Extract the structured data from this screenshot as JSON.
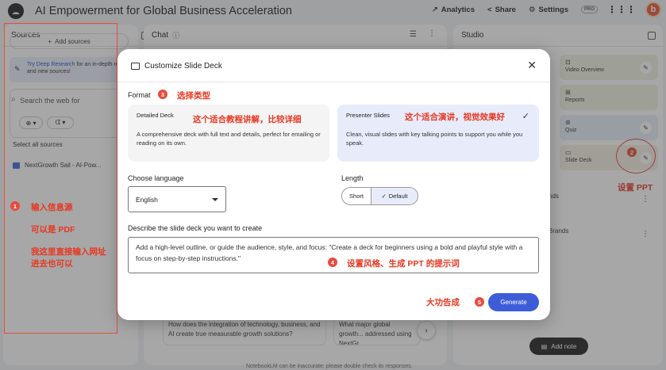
{
  "app": {
    "title": "AI Empowerment for Global Business Acceleration",
    "avatar_letter": "b"
  },
  "topbar": {
    "analytics": "Analytics",
    "share": "Share",
    "settings": "Settings",
    "pro": "PRO"
  },
  "sources": {
    "title": "Sources",
    "add_label": "Add sources",
    "deep_research_link": "Try Deep Research",
    "deep_research_text": "for an in-depth report and new sources!",
    "search_placeholder": "Search the web for",
    "select_all": "Select all sources",
    "items": [
      {
        "label": "NextGrowth Sail - AI-Pow..."
      }
    ]
  },
  "chat": {
    "title": "Chat",
    "suggestions": [
      "How does the integration of technology, business, and AI create true measurable growth solutions?",
      "What major global growth... addressed using NextGr..."
    ],
    "footer": "NotebookLM can be inaccurate; please double check its responses."
  },
  "studio": {
    "title": "Studio",
    "cards": [
      {
        "label": "Video Overview",
        "icon": "video-icon",
        "color": "#eef3e4"
      },
      {
        "label": "Reports",
        "icon": "report-icon",
        "color": "#eef3e4"
      },
      {
        "label": "Quiz",
        "icon": "quiz-icon",
        "color": "#e6eef9"
      },
      {
        "label": "Slide Deck",
        "icon": "slides-icon",
        "color": "#f4efe4"
      }
    ],
    "rows": [
      "nds",
      "Brands"
    ],
    "add_note": "Add note"
  },
  "modal": {
    "title": "Customize Slide Deck",
    "format_label": "Format",
    "formats": [
      {
        "title": "Detailed Deck",
        "desc": "A comprehensive deck with full text and details, perfect for emailing or reading on its own.",
        "selected": false
      },
      {
        "title": "Presenter Slides",
        "desc": "Clean, visual slides with key talking points to support you while you speak.",
        "selected": true
      }
    ],
    "language_label": "Choose language",
    "language_value": "English",
    "length_label": "Length",
    "length_options": [
      "Short",
      "Default"
    ],
    "length_selected": "Default",
    "describe_label": "Describe the slide deck you want to create",
    "describe_placeholder": "Add a high-level outline, or guide the audience, style, and focus: \"Create a deck for beginners using a bold and playful style with a focus on step-by-step instructions.\"",
    "generate": "Generate"
  },
  "annotations": {
    "n1": "1",
    "n2": "2",
    "n3": "3",
    "n4": "4",
    "n5": "5",
    "a1_line1": "输入信息源",
    "a1_line2": "可以是 PDF",
    "a1_line3": "我这里直接输入网址",
    "a1_line4": "进去也可以",
    "a2": "设置 PPT",
    "a3": "选择类型",
    "a3_detailed": "这个适合教程讲解，比较详细",
    "a3_presenter": "这个适合演讲，视觉效果好",
    "a4": "设置风格、生成 PPT 的提示词",
    "a5": "大功告成",
    "color": "#e8361f"
  }
}
